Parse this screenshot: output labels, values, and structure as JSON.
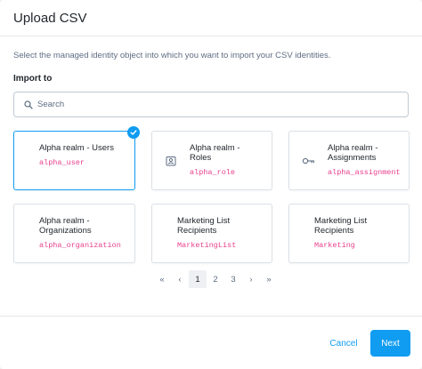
{
  "modal": {
    "title": "Upload CSV",
    "intro": "Select the managed identity object into which you want to import your CSV identities.",
    "import_label": "Import to",
    "search": {
      "placeholder": "Search",
      "value": ""
    }
  },
  "cards": [
    {
      "title_line1": "Alpha realm - Users",
      "title_line2": "",
      "code": "alpha_user",
      "icon": "none",
      "selected": true
    },
    {
      "title_line1": "Alpha realm -",
      "title_line2": "Roles",
      "code": "alpha_role",
      "icon": "badge-icon",
      "selected": false
    },
    {
      "title_line1": "Alpha realm -",
      "title_line2": "Assignments",
      "code": "alpha_assignment",
      "icon": "key-icon",
      "selected": false
    },
    {
      "title_line1": "Alpha realm -",
      "title_line2": "Organizations",
      "code": "alpha_organization",
      "icon": "none",
      "selected": false
    },
    {
      "title_line1": "Marketing List",
      "title_line2": "Recipients",
      "code": "MarketingList",
      "icon": "none",
      "selected": false
    },
    {
      "title_line1": "Marketing List",
      "title_line2": "Recipients",
      "code": "Marketing",
      "icon": "none",
      "selected": false
    }
  ],
  "pagination": {
    "first": "«",
    "prev": "‹",
    "pages": [
      "1",
      "2",
      "3"
    ],
    "current": "1",
    "next": "›",
    "last": "»"
  },
  "footer": {
    "cancel_label": "Cancel",
    "next_label": "Next"
  },
  "colors": {
    "accent": "#109cf1",
    "code": "#e83e8c"
  }
}
